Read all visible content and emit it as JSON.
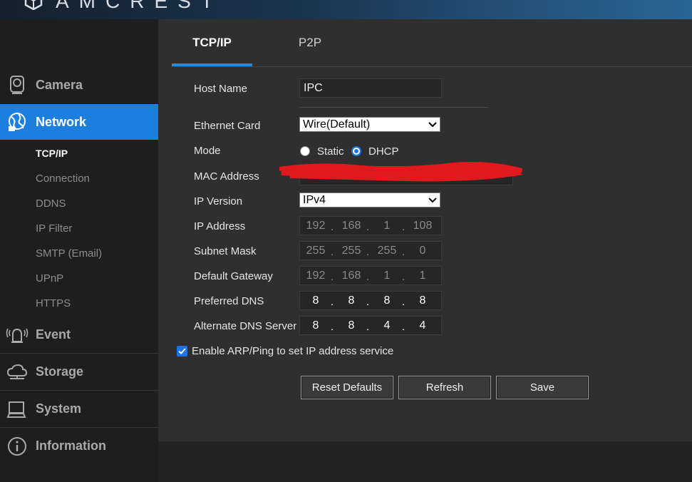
{
  "brand": {
    "logo_text": "AMCREST",
    "logo_icon": "amcrest-cube-icon"
  },
  "sidebar": {
    "items": [
      {
        "label": "Camera",
        "icon": "camera-icon"
      },
      {
        "label": "Network",
        "icon": "network-globe-icon"
      },
      {
        "label": "Event",
        "icon": "alarm-event-icon"
      },
      {
        "label": "Storage",
        "icon": "cloud-storage-icon"
      },
      {
        "label": "System",
        "icon": "computer-icon"
      },
      {
        "label": "Information",
        "icon": "info-icon"
      }
    ],
    "network_submenu": [
      "TCP/IP",
      "Connection",
      "DDNS",
      "IP Filter",
      "SMTP (Email)",
      "UPnP",
      "HTTPS"
    ],
    "active_item": "Network",
    "active_subitem": "TCP/IP"
  },
  "tabs": [
    {
      "label": "TCP/IP"
    },
    {
      "label": "P2P"
    }
  ],
  "form": {
    "host_name": {
      "label": "Host Name",
      "value": "IPC"
    },
    "ethernet_card": {
      "label": "Ethernet Card",
      "value": "Wire(Default)"
    },
    "mode": {
      "label": "Mode",
      "options": [
        "Static",
        "DHCP"
      ],
      "selected": "DHCP"
    },
    "mac_address": {
      "label": "MAC Address"
    },
    "ip_version": {
      "label": "IP Version",
      "value": "IPv4"
    },
    "ip_address": {
      "label": "IP Address",
      "octets": [
        "192",
        "168",
        "1",
        "108"
      ]
    },
    "subnet_mask": {
      "label": "Subnet Mask",
      "octets": [
        "255",
        "255",
        "255",
        "0"
      ]
    },
    "default_gateway": {
      "label": "Default Gateway",
      "octets": [
        "192",
        "168",
        "1",
        "1"
      ]
    },
    "preferred_dns": {
      "label": "Preferred DNS",
      "octets": [
        "8",
        "8",
        "8",
        "8"
      ]
    },
    "alternate_dns": {
      "label": "Alternate DNS Server",
      "octets": [
        "8",
        "8",
        "4",
        "4"
      ]
    },
    "arp_ping": {
      "label": "Enable ARP/Ping to set IP address service",
      "checked": true
    }
  },
  "buttons": {
    "reset": "Reset Defaults",
    "refresh": "Refresh",
    "save": "Save"
  },
  "colors": {
    "accent": "#1c7fe0",
    "redaction": "#e0191f",
    "content_bg": "#2f2f2f",
    "sidebar_bg": "#1e1e1e"
  }
}
